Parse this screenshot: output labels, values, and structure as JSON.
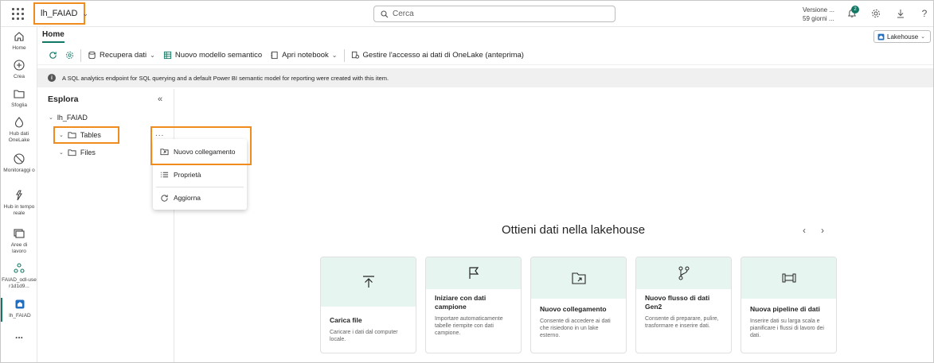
{
  "topbar": {
    "app_name": "lh_FAIAD",
    "search_placeholder": "Cerca",
    "trial_line1": "Versione ...",
    "trial_line2": "59 giorni ...",
    "notification_count": "2"
  },
  "leftnav": [
    {
      "label": "Home",
      "icon": "home-icon"
    },
    {
      "label": "Crea",
      "icon": "create-icon"
    },
    {
      "label": "Sfoglia",
      "icon": "folder-icon"
    },
    {
      "label": "Hub dati OneLake",
      "icon": "onelake-icon"
    },
    {
      "label": "Monitoraggi o",
      "icon": "monitor-icon"
    },
    {
      "label": "Hub in tempo reale",
      "icon": "realtime-icon"
    },
    {
      "label": "Aree di lavoro",
      "icon": "workspaces-icon"
    },
    {
      "label": "FAIAD_odl-user1d1d9...",
      "icon": "workspace-icon"
    },
    {
      "label": "lh_FAIAD",
      "icon": "lakehouse-icon"
    },
    {
      "label": "...",
      "icon": "more-icon"
    }
  ],
  "ribbon": {
    "tab_home": "Home",
    "view_dropdown": "Lakehouse",
    "get_data": "Recupera dati",
    "new_semantic_model": "Nuovo modello semantico",
    "open_notebook": "Apri notebook",
    "manage_access": "Gestire l'accesso ai dati di OneLake (anteprima)"
  },
  "info_message": "A SQL analytics endpoint for SQL querying and a default Power BI semantic model for reporting were created with this item.",
  "explorer": {
    "title": "Esplora",
    "root": "lh_FAIAD",
    "tables": "Tables",
    "files": "Files",
    "more": "..."
  },
  "context_menu": {
    "new_shortcut": "Nuovo collegamento",
    "properties": "Proprietà",
    "refresh": "Aggiorna"
  },
  "get_data": {
    "heading": "Ottieni dati nella lakehouse",
    "cards": [
      {
        "title": "Carica file",
        "desc": "Caricare i dati dal computer locale.",
        "icon": "upload-icon"
      },
      {
        "title": "Iniziare con dati campione",
        "desc": "Importare automaticamente tabelle riempite con dati campione.",
        "icon": "flag-icon"
      },
      {
        "title": "Nuovo collegamento",
        "desc": "Consente di accedere ai dati che risiedono in un lake esterno.",
        "icon": "shortcut-folder-icon"
      },
      {
        "title": "Nuovo flusso di dati Gen2",
        "desc": "Consente di preparare, pulire, trasformare e inserire dati.",
        "icon": "dataflow-icon"
      },
      {
        "title": "Nuova pipeline di dati",
        "desc": "Inserire dati su larga scala e pianificare i flussi di lavoro dei dati.",
        "icon": "pipeline-icon"
      }
    ]
  },
  "colors": {
    "accent": "#117865",
    "highlight": "#f08c1e",
    "card_banner": "#e6f5ef"
  }
}
